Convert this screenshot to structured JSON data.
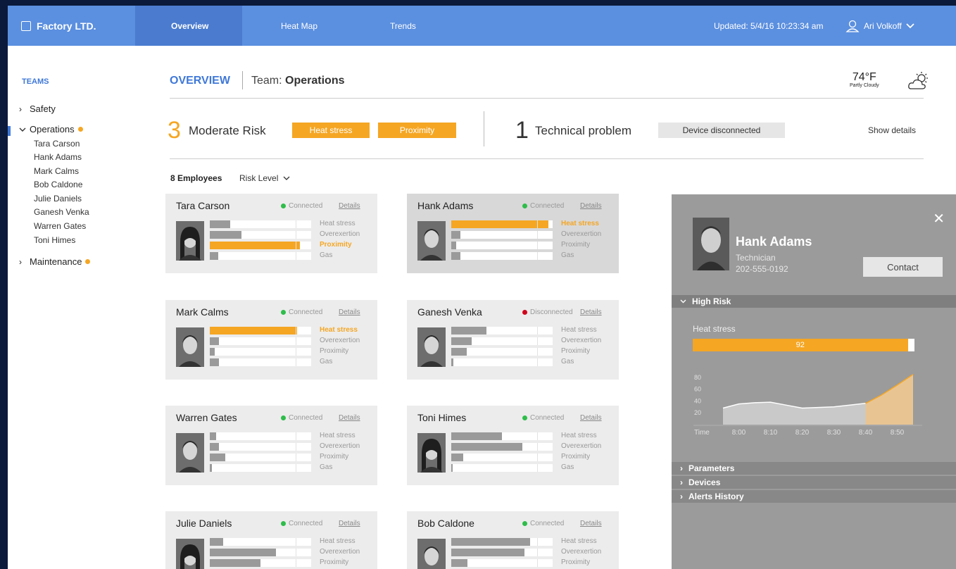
{
  "app": {
    "brand": "Factory LTD."
  },
  "nav": {
    "tabs": [
      {
        "label": "Overview",
        "active": true
      },
      {
        "label": "Heat Map"
      },
      {
        "label": "Trends"
      }
    ]
  },
  "header": {
    "updated": "Updated: 5/4/16 10:23:34 am",
    "user": "Ari Volkoff"
  },
  "sidebar": {
    "title": "TEAMS",
    "groups": [
      {
        "label": "Safety",
        "expanded": false
      },
      {
        "label": "Operations",
        "expanded": true,
        "alert": true,
        "members": [
          "Tara Carson",
          "Hank Adams",
          "Mark Calms",
          "Bob Caldone",
          "Julie Daniels",
          "Ganesh Venka",
          "Warren Gates",
          "Toni Himes"
        ]
      },
      {
        "label": "Maintenance",
        "expanded": false,
        "alert": true
      }
    ]
  },
  "overview": {
    "title": "OVERVIEW",
    "team_prefix": "Team:",
    "team_name": "Operations",
    "weather": {
      "temp": "74°F",
      "condition": "Partly Cloudy",
      "icon": "partly-cloudy-icon"
    }
  },
  "summary": {
    "risk_count": "3",
    "risk_label": "Moderate Risk",
    "risk_tags": [
      "Heat stress",
      "Proximity"
    ],
    "tech_count": "1",
    "tech_label": "Technical problem",
    "tech_tag": "Device disconnected",
    "show_details": "Show details"
  },
  "list": {
    "count_label": "8 Employees",
    "filter_label": "Risk Level"
  },
  "metric_labels": [
    "Heat stress",
    "Overexertion",
    "Proximity",
    "Gas"
  ],
  "employees": [
    {
      "name": "Tara Carson",
      "status": "Connected",
      "details": "Details",
      "values": [
        0.2,
        0.31,
        0.89,
        0.08
      ],
      "hot": [
        false,
        false,
        true,
        false
      ]
    },
    {
      "name": "Hank Adams",
      "status": "Connected",
      "details": "Details",
      "values": [
        0.96,
        0.09,
        0.05,
        0.09
      ],
      "hot": [
        true,
        false,
        false,
        false
      ],
      "selected": true
    },
    {
      "name": "Mark Calms",
      "status": "Connected",
      "details": "Details",
      "values": [
        0.86,
        0.09,
        0.05,
        0.09
      ],
      "hot": [
        true,
        false,
        false,
        false
      ]
    },
    {
      "name": "Ganesh Venka",
      "status": "Disconnected",
      "details": "Details",
      "values": [
        0.35,
        0.2,
        0.15,
        0.02
      ],
      "hot": [
        false,
        false,
        false,
        false
      ]
    },
    {
      "name": "Warren Gates",
      "status": "Connected",
      "details": "Details",
      "values": [
        0.06,
        0.09,
        0.15,
        0.02
      ],
      "hot": [
        false,
        false,
        false,
        false
      ]
    },
    {
      "name": "Toni Himes",
      "status": "Connected",
      "details": "Details",
      "values": [
        0.5,
        0.7,
        0.12,
        0.01
      ],
      "hot": [
        false,
        false,
        false,
        false
      ]
    },
    {
      "name": "Julie Daniels",
      "status": "Connected",
      "details": "Details",
      "values": [
        0.13,
        0.65,
        0.5,
        0.0
      ],
      "hot": [
        false,
        false,
        false,
        false
      ]
    },
    {
      "name": "Bob Caldone",
      "status": "Connected",
      "details": "Details",
      "values": [
        0.78,
        0.72,
        0.16,
        0.0
      ],
      "hot": [
        false,
        false,
        false,
        false
      ]
    }
  ],
  "panel": {
    "name": "Hank Adams",
    "role": "Technician",
    "phone": "202-555-0192",
    "contact": "Contact",
    "close_icon": "close-icon",
    "high_risk": "High Risk",
    "metric_label": "Heat stress",
    "metric_value": "92",
    "metric_fraction": 0.97,
    "sections": [
      "Parameters",
      "Devices",
      "Alerts History"
    ]
  },
  "chart_data": {
    "type": "area",
    "x_label": "Time",
    "categories": [
      "8:00",
      "8:10",
      "8:20",
      "8:30",
      "8:40",
      "8:50"
    ],
    "y_ticks": [
      20,
      40,
      60,
      80
    ],
    "series": [
      {
        "x": [
          "7:55",
          "8:00",
          "8:05",
          "8:10",
          "8:15",
          "8:20",
          "8:25",
          "8:30",
          "8:35",
          "8:40",
          "8:45",
          "8:50",
          "8:55"
        ],
        "values": [
          28,
          35,
          37,
          38,
          33,
          28,
          29,
          30,
          33,
          36,
          50,
          67,
          85
        ]
      }
    ],
    "ylim": [
      0,
      100
    ],
    "highlight_from": "8:40",
    "colors": {
      "normal": "#c9c9c9",
      "line": "#ffffff",
      "alert_fill": "#e8c493",
      "alert_line": "#f5a623"
    }
  },
  "colors": {
    "accent": "#5b8fdf",
    "alert": "#f5a623",
    "connected": "#2ebd4a",
    "disconnected": "#d0021b"
  }
}
